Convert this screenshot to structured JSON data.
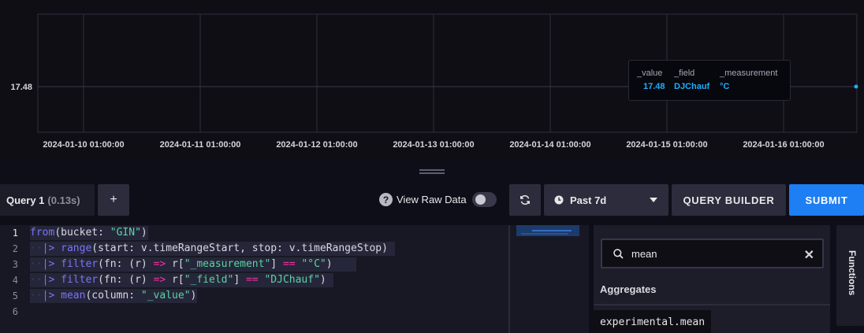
{
  "chart_data": {
    "type": "line",
    "x_tick_labels": [
      "2024-01-10 01:00:00",
      "2024-01-11 01:00:00",
      "2024-01-12 01:00:00",
      "2024-01-13 01:00:00",
      "2024-01-14 01:00:00",
      "2024-01-15 01:00:00",
      "2024-01-16 01:00:00"
    ],
    "y_tick_labels": [
      "17.48"
    ],
    "series": [
      {
        "values": [
          17.48
        ]
      }
    ],
    "point_x_fraction": 1.0,
    "grid": true,
    "point_color": "#22adf6"
  },
  "tooltip": {
    "headers": [
      "_value",
      "_field",
      "_measurement"
    ],
    "values": [
      "17.48",
      "DJChauf",
      "°C"
    ]
  },
  "toolbar": {
    "query_tab": "Query 1",
    "query_time": "(0.13s)",
    "add_query": "+",
    "help": "?",
    "view_raw_data": "View Raw Data",
    "raw_data_enabled": false,
    "time_range": "Past 7d",
    "query_builder": "QUERY BUILDER",
    "submit": "SUBMIT",
    "accent_color": "#1e7ef3"
  },
  "editor": {
    "line_numbers": [
      "1",
      "2",
      "3",
      "4",
      "5",
      "6"
    ]
  },
  "functions": {
    "search_value": "mean",
    "heading": "Aggregates",
    "results": [
      "experimental.mean"
    ],
    "tab_label": "Functions"
  }
}
